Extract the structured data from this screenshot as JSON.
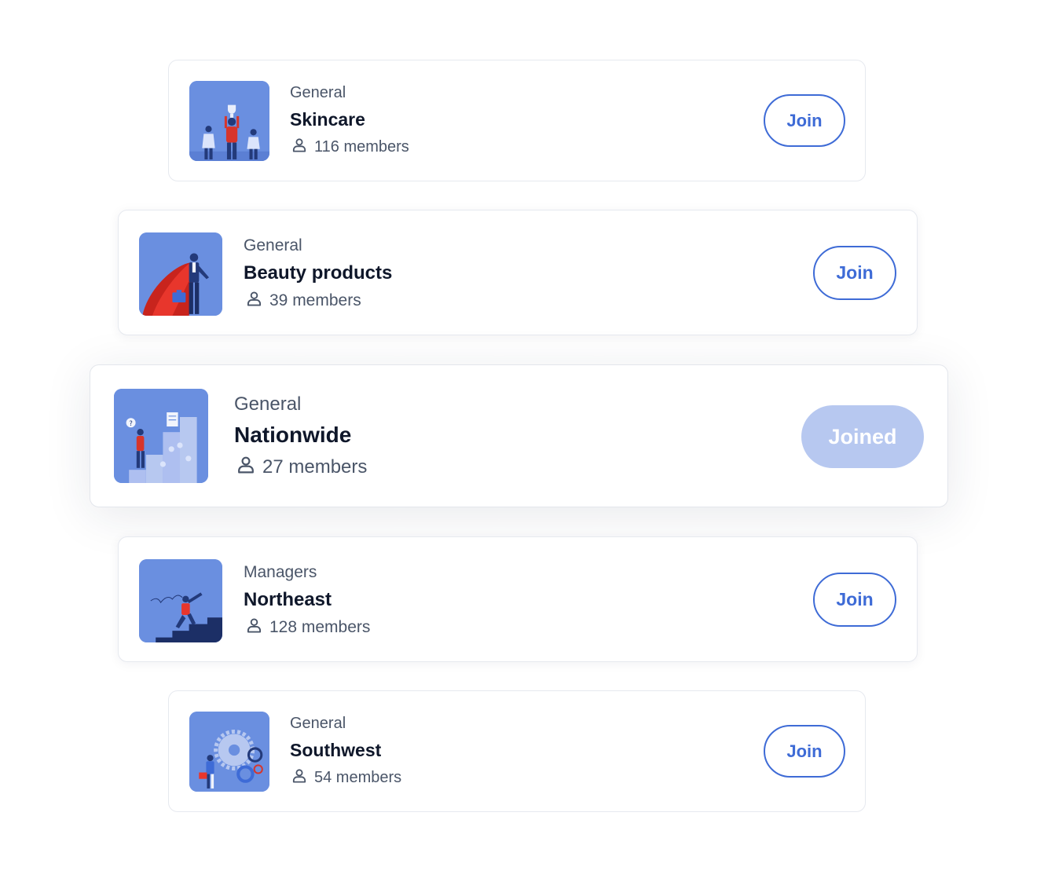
{
  "colors": {
    "accent": "#3e6bd6",
    "joined_bg": "#b7c8f0",
    "thumb_bg": "#6a8fe0"
  },
  "groups": [
    {
      "category": "General",
      "name": "Skincare",
      "members": "116 members",
      "action": "Join",
      "state": "join",
      "thumbnail": "trophy-team-illustration"
    },
    {
      "category": "General",
      "name": "Beauty products",
      "members": "39 members",
      "action": "Join",
      "state": "join",
      "thumbnail": "superhero-businessman-illustration"
    },
    {
      "category": "General",
      "name": "Nationwide",
      "members": "27 members",
      "action": "Joined",
      "state": "joined",
      "thumbnail": "puzzle-stairs-illustration"
    },
    {
      "category": "Managers",
      "name": "Northeast",
      "members": "128 members",
      "action": "Join",
      "state": "join",
      "thumbnail": "telescope-stairs-illustration"
    },
    {
      "category": "General",
      "name": "Southwest",
      "members": "54 members",
      "action": "Join",
      "state": "join",
      "thumbnail": "gears-illustration"
    }
  ]
}
